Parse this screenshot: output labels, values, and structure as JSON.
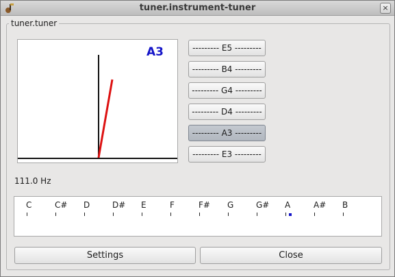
{
  "window": {
    "title": "tuner.instrument-tuner",
    "close_glyph": "×"
  },
  "group": {
    "title": "tuner.tuner"
  },
  "needle": {
    "note": "A3",
    "deviation_fraction": 0.2,
    "needle_color": "#dd1111",
    "note_color": "#1414c8"
  },
  "strings": [
    {
      "label": "--------- E5 ---------",
      "active": false
    },
    {
      "label": "--------- B4 ---------",
      "active": false
    },
    {
      "label": "--------- G4 ---------",
      "active": false
    },
    {
      "label": "--------- D4 ---------",
      "active": false
    },
    {
      "label": "--------- A3 ---------",
      "active": true
    },
    {
      "label": "--------- E3 ---------",
      "active": false
    }
  ],
  "frequency": "111.0 Hz",
  "scale": {
    "notes": [
      "C",
      "C#",
      "D",
      "D#",
      "E",
      "F",
      "F#",
      "G",
      "G#",
      "A",
      "A#",
      "B"
    ],
    "current_note": "A"
  },
  "buttons": {
    "settings": "Settings",
    "close": "Close"
  }
}
